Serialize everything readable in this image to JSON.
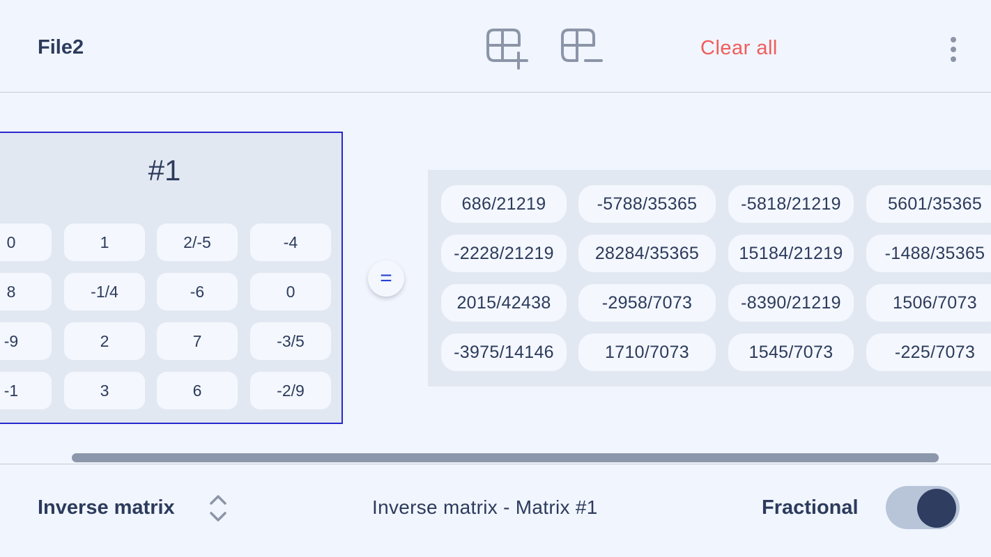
{
  "header": {
    "file_title": "File2",
    "add_column_icon": "add-column-icon",
    "remove_column_icon": "remove-column-icon",
    "clear_all_label": "Clear all",
    "more_icon": "more-vertical-icon"
  },
  "matrix_a": {
    "title": "#1",
    "rows": [
      [
        "0",
        "1",
        "2/-5",
        "-4"
      ],
      [
        "8",
        "-1/4",
        "-6",
        "0"
      ],
      [
        "-9",
        "2",
        "7",
        "-3/5"
      ],
      [
        "-1",
        "3",
        "6",
        "-2/9"
      ]
    ]
  },
  "equals_label": "=",
  "result": {
    "rows": [
      [
        "686/21219",
        "-5788/35365",
        "-5818/21219",
        "5601/35365"
      ],
      [
        "-2228/21219",
        "28284/35365",
        "15184/21219",
        "-1488/35365"
      ],
      [
        "2015/42438",
        "-2958/7073",
        "-8390/21219",
        "1506/7073"
      ],
      [
        "-3975/14146",
        "1710/7073",
        "1545/7073",
        "-225/7073"
      ]
    ]
  },
  "footer": {
    "operation_label": "Inverse matrix",
    "operation_description": "Inverse matrix - Matrix #1",
    "fractional_label": "Fractional",
    "fractional_on": true
  },
  "colors": {
    "accent_blue": "#2828cc",
    "danger_red": "#ef5d5d",
    "text_dark": "#2c3b5c",
    "panel_bg": "#e2e8f2",
    "page_bg": "#f1f5fd"
  }
}
